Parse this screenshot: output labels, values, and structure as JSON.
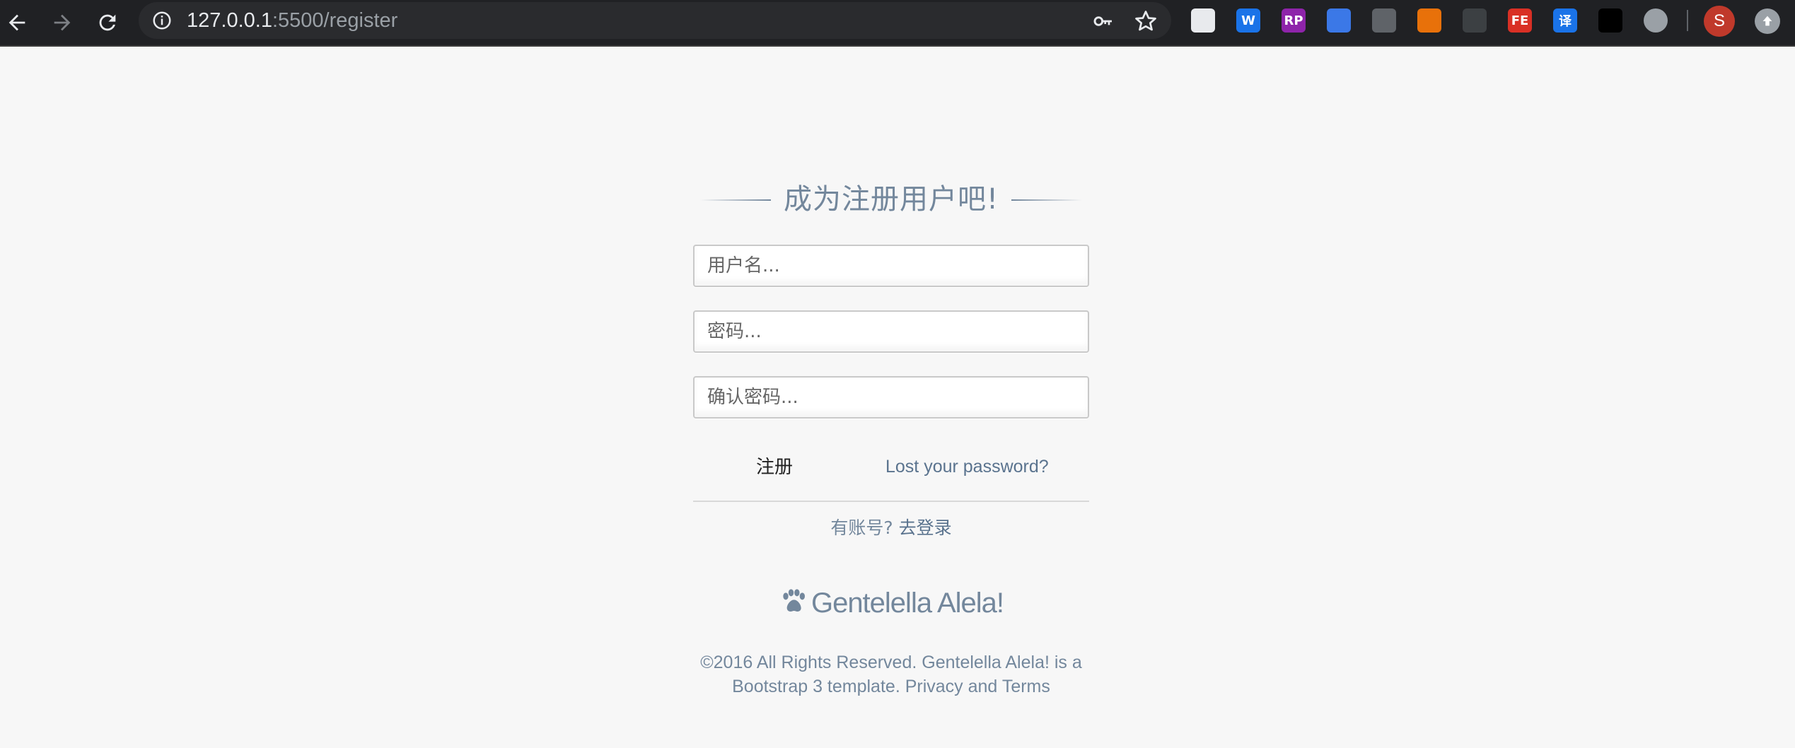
{
  "browser": {
    "url_host": "127.0.0.1",
    "url_rest": ":5500/register",
    "profile_initial": "S",
    "extensions": [
      {
        "name": "extension-notes-icon",
        "label": "",
        "color": "#e8eaed"
      },
      {
        "name": "extension-word-icon",
        "label": "W",
        "color": "#1a73e8"
      },
      {
        "name": "extension-rp-icon",
        "label": "RP",
        "color": "#8e24aa"
      },
      {
        "name": "extension-target-icon",
        "label": "",
        "color": "#3b78e7"
      },
      {
        "name": "extension-box-icon",
        "label": "",
        "color": "#5f6368"
      },
      {
        "name": "extension-spiral-icon",
        "label": "",
        "color": "#e8710a"
      },
      {
        "name": "extension-eraser-icon",
        "label": "",
        "color": "#3c4043"
      },
      {
        "name": "extension-fe-icon",
        "label": "FE",
        "color": "#d93025"
      },
      {
        "name": "extension-translate-icon",
        "label": "译",
        "color": "#1a73e8"
      },
      {
        "name": "extension-glasses-icon",
        "label": "",
        "color": "#000000"
      },
      {
        "name": "extension-circle-icon",
        "label": "",
        "color": "#9aa0a6"
      }
    ]
  },
  "page": {
    "title": "成为注册用户吧!",
    "username_placeholder": "用户名...",
    "password_placeholder": "密码...",
    "confirm_placeholder": "确认密码...",
    "register_label": "注册",
    "lost_password": "Lost your password?",
    "have_account": "有账号?",
    "go_login": "去登录",
    "brand": "Gentelella Alela!",
    "footer_line1": "©2016 All Rights Reserved. Gentelella Alela! is a",
    "footer_line2": "Bootstrap 3 template. Privacy and Terms"
  },
  "colors": {
    "accent": "#73879c",
    "link": "#5a738e",
    "background": "#f7f7f7",
    "chrome": "#202124"
  }
}
